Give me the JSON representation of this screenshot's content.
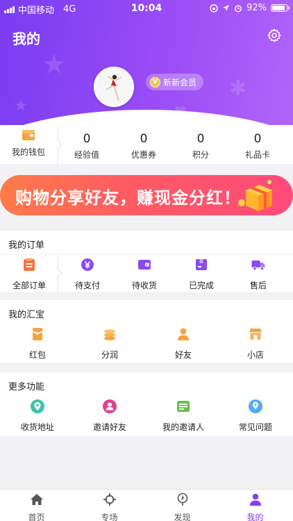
{
  "status_bar": {
    "carrier": "中国移动",
    "network": "4G",
    "time": "10:04",
    "battery": "92%"
  },
  "header": {
    "title": "我的",
    "member_badge": "新新会员"
  },
  "stats": {
    "wallet_label": "我的钱包",
    "items": [
      {
        "value": "0",
        "label": "经验值"
      },
      {
        "value": "0",
        "label": "优惠券"
      },
      {
        "value": "0",
        "label": "积分"
      },
      {
        "value": "0",
        "label": "礼品卡"
      }
    ]
  },
  "banner": {
    "text": "购物分享好友，赚现金分红！"
  },
  "orders": {
    "title": "我的订单",
    "items": [
      {
        "label": "全部订单",
        "icon": "clipboard-icon"
      },
      {
        "label": "待支付",
        "icon": "yen-wallet-icon"
      },
      {
        "label": "待收货",
        "icon": "wallet-icon"
      },
      {
        "label": "已完成",
        "icon": "box-icon"
      },
      {
        "label": "售后",
        "icon": "truck-icon"
      }
    ]
  },
  "huibao": {
    "title": "我的汇宝",
    "items": [
      {
        "label": "红包",
        "icon": "red-packet-icon"
      },
      {
        "label": "分润",
        "icon": "coins-icon"
      },
      {
        "label": "好友",
        "icon": "person-icon"
      },
      {
        "label": "小店",
        "icon": "store-icon"
      }
    ]
  },
  "more": {
    "title": "更多功能",
    "items": [
      {
        "label": "收货地址",
        "icon": "location-pin-icon"
      },
      {
        "label": "邀请好友",
        "icon": "invite-icon"
      },
      {
        "label": "我的邀请人",
        "icon": "id-card-icon"
      },
      {
        "label": "常见问题",
        "icon": "help-icon"
      }
    ]
  },
  "tabbar": {
    "items": [
      {
        "label": "首页",
        "icon": "home-icon"
      },
      {
        "label": "专场",
        "icon": "target-icon"
      },
      {
        "label": "发现",
        "icon": "discover-icon"
      },
      {
        "label": "我的",
        "icon": "profile-icon",
        "active": true
      }
    ]
  },
  "colors": {
    "brand_purple": "#8a3cf0",
    "orange": "#f5a33c",
    "banner_red": "#ff5a64"
  }
}
